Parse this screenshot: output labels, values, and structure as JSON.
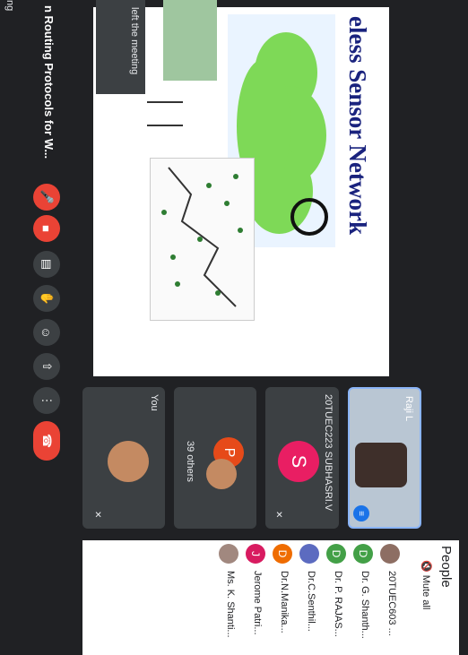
{
  "meeting": {
    "title": "n Routing Protocols for W..."
  },
  "slide": {
    "title": "eless Sensor Network"
  },
  "toast": {
    "text": "left the meeting"
  },
  "tiles": {
    "you_label": "You",
    "others_label": "39 others",
    "others_initial": "P",
    "student_label": "20TUEC223 SUBHASRI.V",
    "student_initial": "S",
    "speaker_label": "Raji L"
  },
  "people": {
    "title": "People",
    "mute_all": "Mute all",
    "rows": [
      {
        "name": "20TUEC603 ...",
        "initial": "",
        "color": "#8d6e63"
      },
      {
        "name": "Dr. G. Shanth...",
        "initial": "D",
        "color": "#43a047"
      },
      {
        "name": "Dr. P. RAJAS...",
        "initial": "D",
        "color": "#43a047"
      },
      {
        "name": "Dr.C.Senthil...",
        "initial": "",
        "color": "#5c6bc0"
      },
      {
        "name": "Dr.N.Manika...",
        "initial": "D",
        "color": "#ef6c00"
      },
      {
        "name": "Jerome Patri...",
        "initial": "J",
        "color": "#d81b60"
      },
      {
        "name": "Ms. K. Shanti...",
        "initial": "",
        "color": "#a1887f"
      }
    ]
  },
  "partial_label": "ng"
}
